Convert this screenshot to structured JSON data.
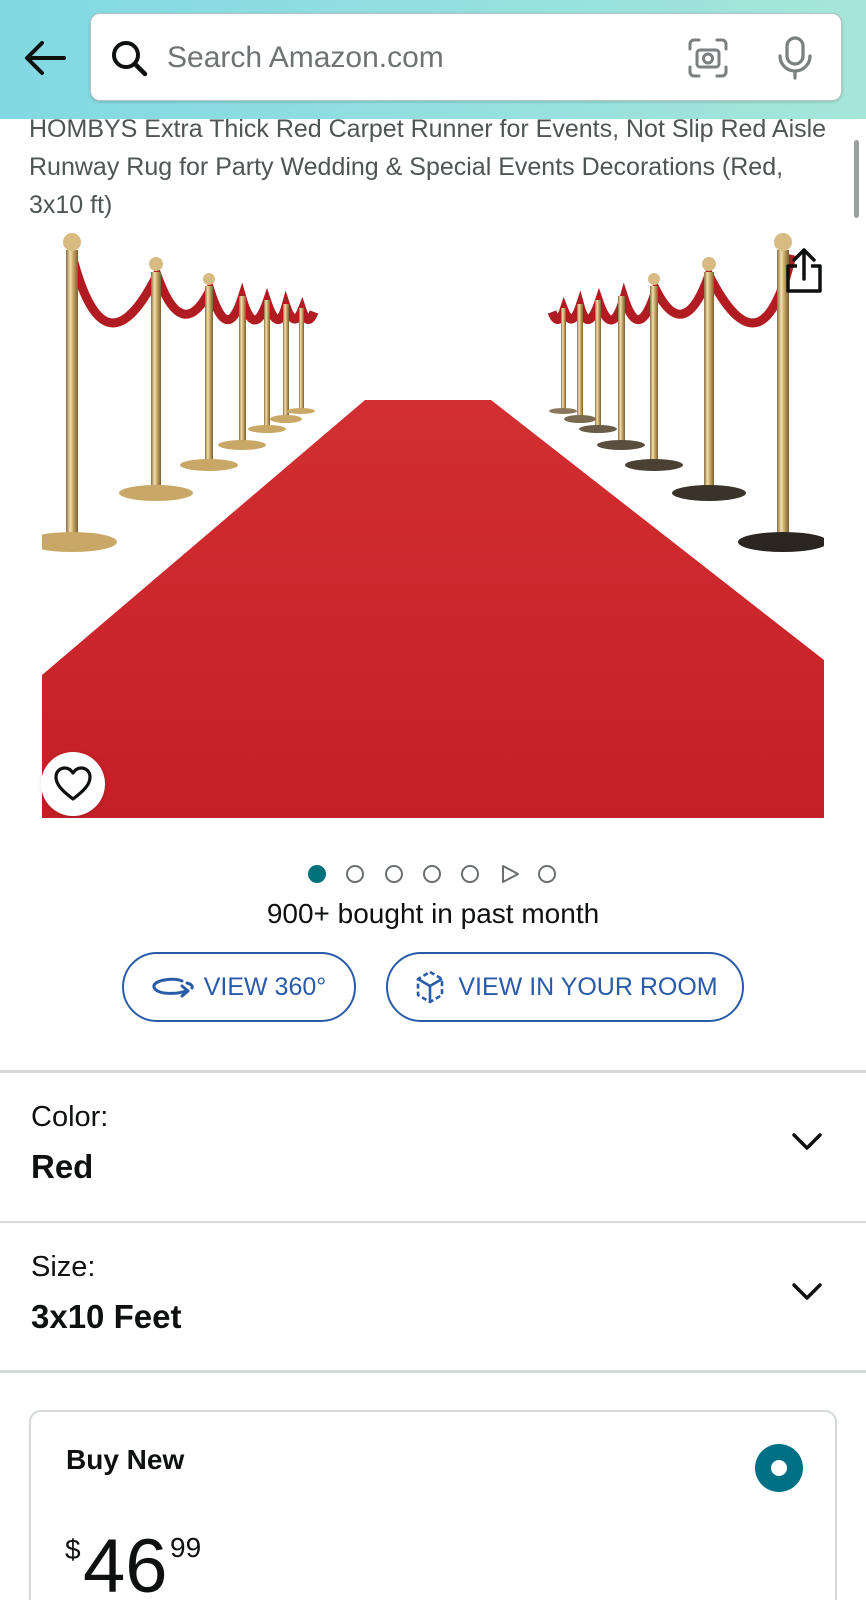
{
  "search": {
    "placeholder": "Search Amazon.com"
  },
  "product": {
    "title": "HOMBYS Extra Thick Red Carpet Runner for Events, Not Slip Red Aisle Runway Rug for Party Wedding & Special Events Decorations (Red, 3x10 ft)",
    "image_icons": [
      "share-icon",
      "heart-icon"
    ],
    "carousel": {
      "count": 7,
      "active_index": 0,
      "video_index": 5
    },
    "bought_text": "900+ bought in past month"
  },
  "actions": {
    "view360_label": "VIEW 360°",
    "view_room_label": "VIEW IN YOUR ROOM"
  },
  "variants": {
    "color": {
      "label": "Color:",
      "value": "Red"
    },
    "size": {
      "label": "Size:",
      "value": "3x10 Feet"
    }
  },
  "buy_box": {
    "label": "Buy New",
    "price": {
      "symbol": "$",
      "whole": "46",
      "fraction": "99"
    }
  },
  "colors": {
    "accent": "#007185",
    "link": "#2a5ba8",
    "carpet": "#c8252b",
    "header_start": "#82d8e3",
    "header_end": "#a5e6d8"
  }
}
